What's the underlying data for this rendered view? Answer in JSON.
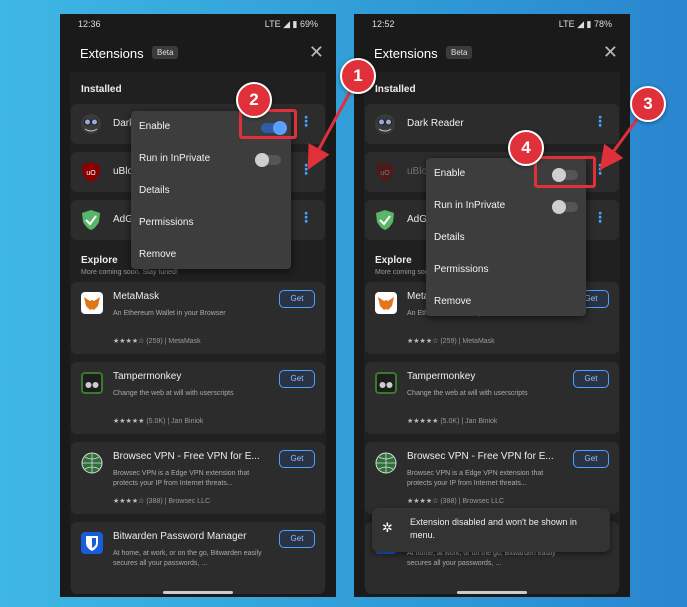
{
  "colors": {
    "accent": "#4aa3ff",
    "callout": "#e0303a",
    "background": "#2f9ad6"
  },
  "header": {
    "title": "Extensions",
    "badge": "Beta"
  },
  "sections": {
    "installed": "Installed",
    "explore": "Explore",
    "explore_sub": "More coming soon. Stay tuned!"
  },
  "get_label": "Get",
  "menu": {
    "enable": "Enable",
    "run_inprivate": "Run in InPrivate",
    "details": "Details",
    "permissions": "Permissions",
    "remove": "Remove"
  },
  "phone1": {
    "time": "12:36",
    "status": "LTE ◢ ▮ 69%",
    "installed": [
      {
        "name": "Dark Reader",
        "icon": "dark-reader-icon"
      },
      {
        "name": "uBlock Origin",
        "icon": "ublock-icon"
      },
      {
        "name": "AdGuard AdBlocker",
        "icon": "adguard-icon"
      }
    ],
    "enable_toggle": "on",
    "run_inprivate_toggle": "off"
  },
  "phone2": {
    "time": "12:52",
    "status": "LTE ◢ ▮ 78%",
    "installed": [
      {
        "name": "Dark Reader",
        "icon": "dark-reader-icon"
      },
      {
        "name": "uBlock Origin",
        "icon": "ublock-icon"
      },
      {
        "name": "AdGuard AdBlocker",
        "icon": "adguard-icon"
      }
    ],
    "enable_toggle": "off",
    "run_inprivate_toggle": "off",
    "toast": "Extension disabled and won't be shown in menu."
  },
  "explore_items": [
    {
      "name": "MetaMask",
      "desc": "An Ethereum Wallet in your Browser",
      "stars": "★★★★☆",
      "meta": "(259) | MetaMask",
      "icon": "metamask-icon"
    },
    {
      "name": "Tampermonkey",
      "desc": "Change the web at will with userscripts",
      "stars": "★★★★★",
      "meta": "(5.0K) | Jan Biniok",
      "icon": "tampermonkey-icon"
    },
    {
      "name": "Browsec VPN - Free VPN for E...",
      "desc": "Browsec VPN is a Edge VPN extension that protects your IP from Internet threats...",
      "stars": "★★★★☆",
      "meta": "(388) | Browsec LLC",
      "icon": "browsec-icon"
    },
    {
      "name": "Bitwarden Password Manager",
      "desc": "At home, at work, or on the go, Bitwarden easily secures all your passwords, ...",
      "stars": "★★★★★",
      "meta": "",
      "icon": "bitwarden-icon"
    }
  ],
  "callouts": [
    "1",
    "2",
    "3",
    "4"
  ]
}
